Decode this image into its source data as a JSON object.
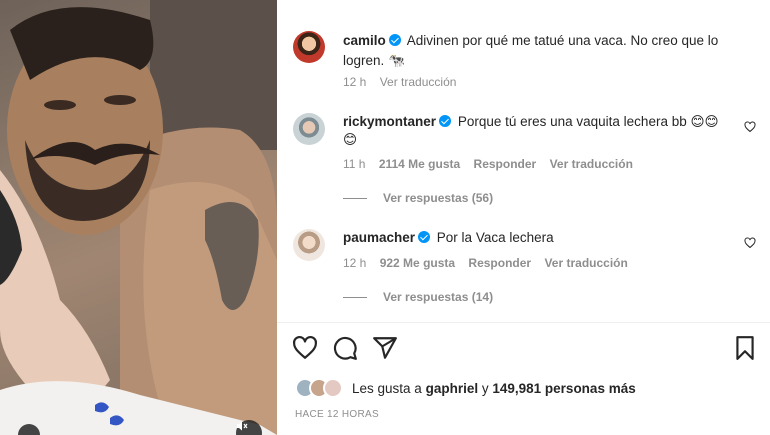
{
  "post": {
    "caption": {
      "username": "camilo",
      "text": "Adivinen por qué me tatué una vaca. No creo que lo",
      "text_line2": "logren.",
      "emoji": "🐄",
      "time": "12 h",
      "translate": "Ver traducción"
    },
    "comments": [
      {
        "username": "rickymontaner",
        "text": "Porque tú eres una vaquita lechera bb 😊😊",
        "text_line2": "😊",
        "time": "11 h",
        "likes": "2114 Me gusta",
        "reply": "Responder",
        "translate": "Ver traducción",
        "view_replies": "Ver respuestas (56)"
      },
      {
        "username": "paumacher",
        "text": "Por la Vaca lechera",
        "time": "12 h",
        "likes": "922 Me gusta",
        "reply": "Responder",
        "translate": "Ver traducción",
        "view_replies": "Ver respuestas (14)"
      }
    ],
    "likes_summary": {
      "prefix": "Les gusta a",
      "user": "gaphriel",
      "connector": "y",
      "count": "149,981 personas más"
    },
    "timestamp": "HACE 12 HORAS"
  },
  "colors": {
    "verified": "#0095f6",
    "secondary_text": "#8e8e8e",
    "primary_text": "#262626"
  },
  "icons": [
    "heart-icon",
    "comment-icon",
    "share-icon",
    "bookmark-icon",
    "mute-icon",
    "verified-icon"
  ]
}
